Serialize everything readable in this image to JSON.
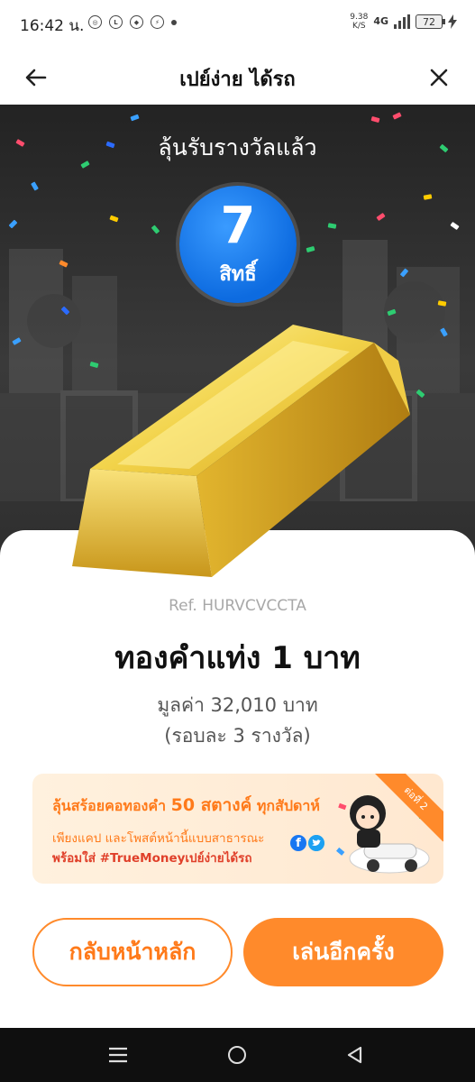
{
  "status_bar": {
    "time": "16:42 น.",
    "net_speed": "9.38",
    "net_unit": "K/S",
    "network": "4G",
    "battery": "72"
  },
  "header": {
    "title": "เปย์ง่าย ได้รถ",
    "back_icon": "arrow-left-icon",
    "close_icon": "close-icon"
  },
  "hero": {
    "title": "ลุ้นรับรางวัลแล้ว",
    "rights_count": "7",
    "rights_unit": "สิทธิ์"
  },
  "prize": {
    "ref": "Ref. HURVCVCCTA",
    "name": "ทองคำแท่ง 1 บาท",
    "value": "มูลค่า 32,010 บาท",
    "rounds": "(รอบละ 3 รางวัล)"
  },
  "promo": {
    "line1_prefix": "ลุ้นสร้อยคอทองคำ",
    "line1_highlight": "50 สตางค์",
    "line1_suffix": "ทุกสัปดาห์",
    "line2": "เพียงแคป และโพสต์หน้านี้แบบสาธารณะ",
    "line3": "พร้อมใส่ #TrueMoneyเปย์ง่ายได้รถ",
    "ribbon": "ต่อที่ 2",
    "accent_color": "#ff8a2b"
  },
  "buttons": {
    "home_label": "กลับหน้าหลัก",
    "play_again_label": "เล่นอีกครั้ง"
  }
}
